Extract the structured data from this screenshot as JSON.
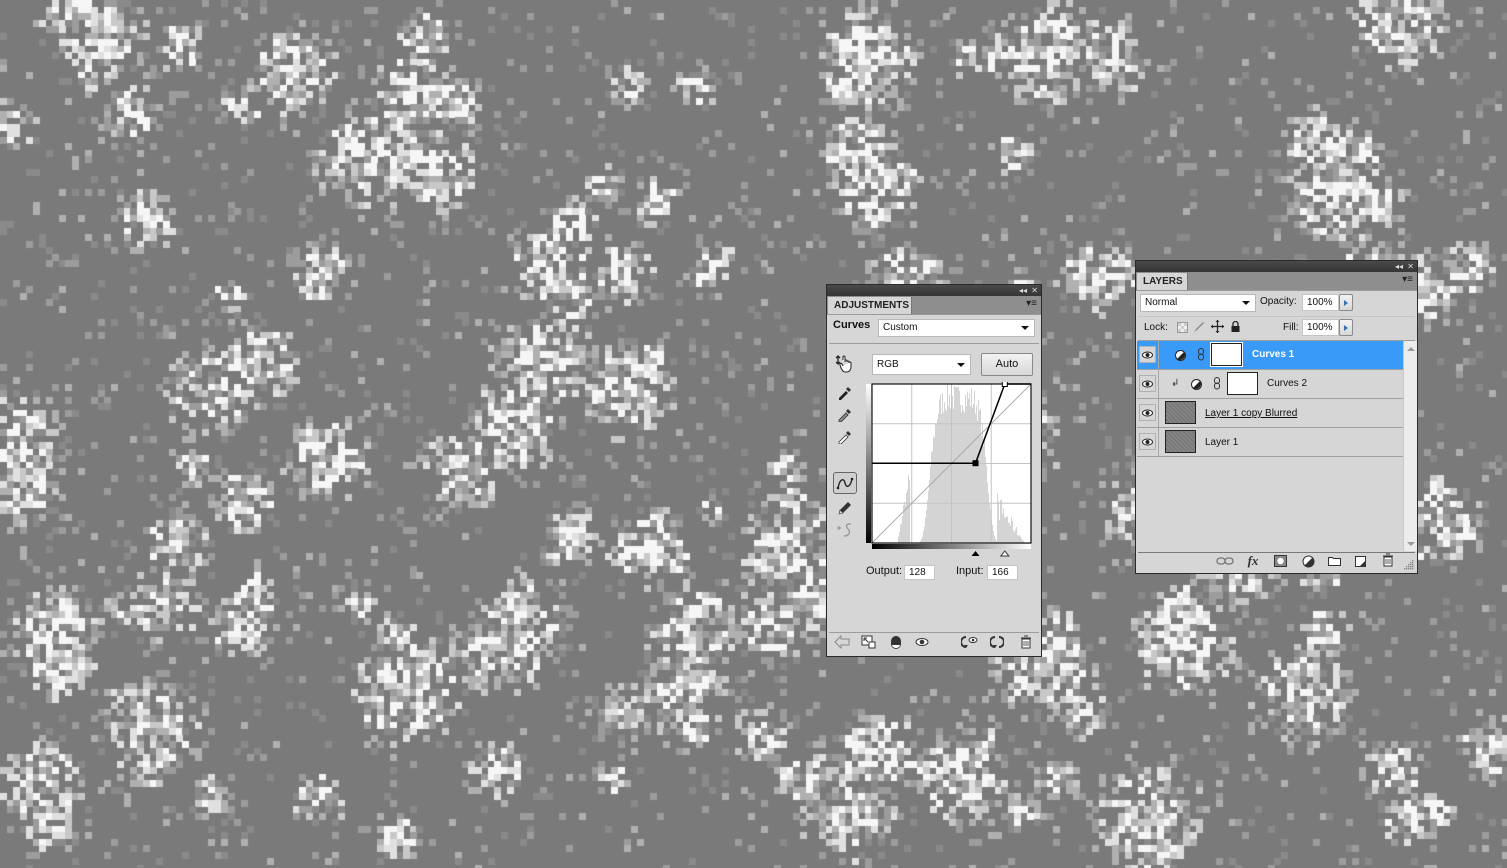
{
  "canvas": {
    "background_base": "#7a7a7a",
    "noise_colors": [
      "#8a8a8a",
      "#9c9c9c",
      "#b0b0b0",
      "#c8c8c8",
      "#e0e0e0",
      "#f6f6f6"
    ]
  },
  "adjustments": {
    "tab_label": "ADJUSTMENTS",
    "collapse_glyph": "◂◂",
    "close_glyph": "✕",
    "menu_glyph": "▾≡",
    "type_label": "Curves",
    "preset_value": "Custom",
    "channel_value": "RGB",
    "auto_label": "Auto",
    "output_label": "Output:",
    "output_value": "128",
    "input_label": "Input:",
    "input_value": "166",
    "curve": {
      "points": [
        [
          0,
          128
        ],
        [
          166,
          128
        ],
        [
          213,
          255
        ],
        [
          255,
          255
        ]
      ],
      "selected_point": [
        166,
        128
      ],
      "range": [
        0,
        255
      ]
    },
    "histogram_hint": "bell-shaped, mid-to-light tones",
    "tools": [
      "target-adjust-hand-icon",
      "black-eyedropper-icon",
      "gray-eyedropper-icon",
      "white-eyedropper-icon",
      "curve-point-tool-icon",
      "pencil-tool-icon",
      "smooth-curve-icon"
    ],
    "footer_icons": [
      "back-arrow-icon",
      "expanded-view-icon",
      "clip-to-layer-icon",
      "visibility-eye-icon",
      "view-previous-state-icon",
      "reset-icon",
      "delete-icon"
    ]
  },
  "layers": {
    "tab_label": "LAYERS",
    "collapse_glyph": "◂◂",
    "close_glyph": "✕",
    "menu_glyph": "▾≡",
    "blend_mode": "Normal",
    "opacity_label": "Opacity:",
    "opacity_value": "100%",
    "lock_label": "Lock:",
    "fill_label": "Fill:",
    "fill_value": "100%",
    "items": [
      {
        "name": "Curves 1",
        "type": "adjustment",
        "selected": true,
        "clipped": false,
        "visible": true
      },
      {
        "name": "Curves 2",
        "type": "adjustment",
        "selected": false,
        "clipped": true,
        "visible": true
      },
      {
        "name": "Layer 1 copy Blurred",
        "type": "pixel",
        "selected": false,
        "clipped": false,
        "visible": true,
        "underlined": true
      },
      {
        "name": "Layer 1",
        "type": "pixel",
        "selected": false,
        "clipped": false,
        "visible": true
      }
    ],
    "footer_icons": [
      "link-layers-icon",
      "fx-icon",
      "add-mask-icon",
      "new-adjustment-icon",
      "new-group-icon",
      "new-layer-icon",
      "delete-layer-icon"
    ],
    "selection_color": "#3a9af8"
  }
}
